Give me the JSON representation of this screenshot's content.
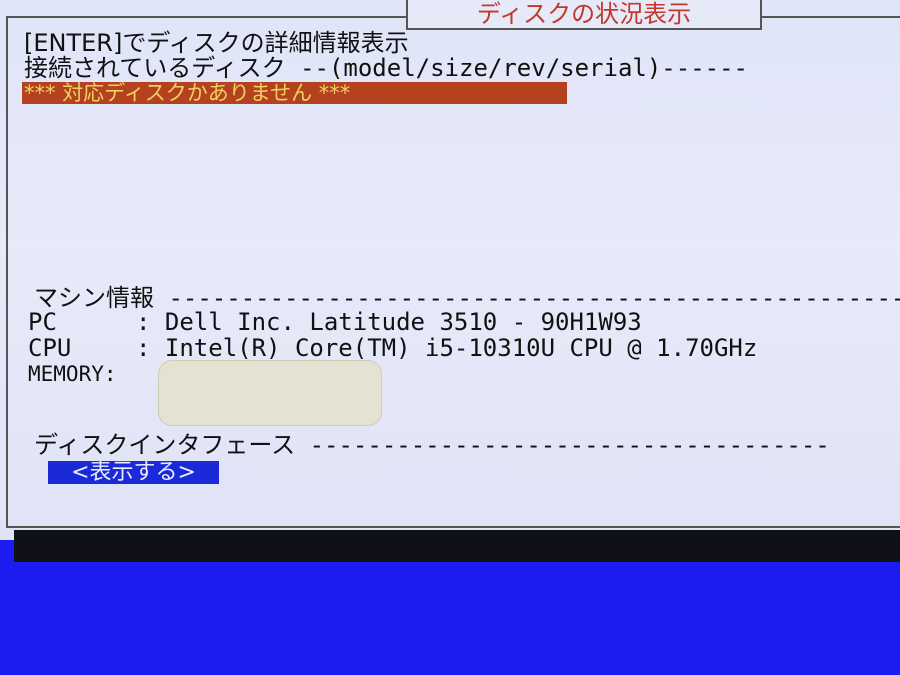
{
  "screen_title": "ディスクの状況表示",
  "enter_hint": "[ENTER]でディスクの詳細情報表示",
  "connected_disks": {
    "label": "接続されているディスク",
    "columns": "--(model/size/rev/serial)------"
  },
  "no_disk_alert": "*** 対応ディスクかありません ***",
  "machine_info": {
    "heading": "マシン情報",
    "rule": "---------------------------------------------------",
    "rows": [
      {
        "key": "PC",
        "sep": ":",
        "value": "Dell Inc. Latitude 3510 - 90H1W93"
      },
      {
        "key": "CPU",
        "sep": ":",
        "value": "Intel(R) Core(TM) i5-10310U CPU @ 1.70GHz"
      },
      {
        "key": "MEMORY",
        "sep": ":",
        "value": ""
      }
    ]
  },
  "disk_interface": {
    "heading": "ディスクインタフェース",
    "rule": "------------------------------------",
    "button": "<表示する>"
  }
}
